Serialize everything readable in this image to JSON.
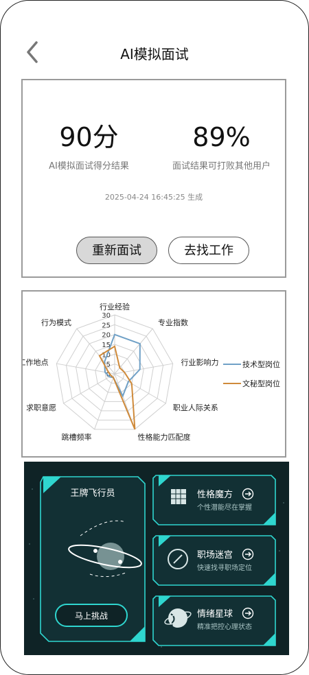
{
  "header": {
    "title": "AI模拟面试",
    "back_icon": "chevron-left-icon"
  },
  "result": {
    "score_value": "90分",
    "score_label": "AI模拟面试得分结果",
    "beat_value": "89%",
    "beat_label": "面试结果可打败其他用户",
    "timestamp": "2025-04-24  16:45:25 生成",
    "retry_label": "重新面试",
    "find_job_label": "去找工作"
  },
  "chart_data": {
    "type": "radar",
    "axes": [
      "行业经验",
      "专业指数",
      "行业影响力",
      "职业人际关系",
      "性格能力匹配度",
      "跳槽频率",
      "求职意愿",
      "工作地点",
      "行为模式"
    ],
    "scale_labels": [
      "30",
      "25",
      "20",
      "15",
      "10",
      "5",
      "0"
    ],
    "rlim": [
      0,
      30
    ],
    "series": [
      {
        "name": "技术型岗位",
        "color": "#6fa0c6",
        "values": [
          20,
          20,
          13,
          8,
          12,
          2,
          3,
          5,
          8
        ]
      },
      {
        "name": "文秘型岗位",
        "color": "#cf8a3a",
        "values": [
          14,
          4,
          5,
          10,
          30,
          2,
          2,
          3,
          12
        ]
      }
    ],
    "legend_position": "right"
  },
  "game": {
    "hero_title": "王牌飞行员",
    "hero_button": "马上挑战",
    "items": [
      {
        "title": "性格魔方",
        "subtitle": "个性潜能尽在掌握",
        "icon": "cube-icon"
      },
      {
        "title": "职场迷宫",
        "subtitle": "快速找寻职场定位",
        "icon": "compass-icon"
      },
      {
        "title": "情绪星球",
        "subtitle": "精准把控心理状态",
        "icon": "planet-icon"
      }
    ],
    "accent": "#2fd6cf"
  }
}
